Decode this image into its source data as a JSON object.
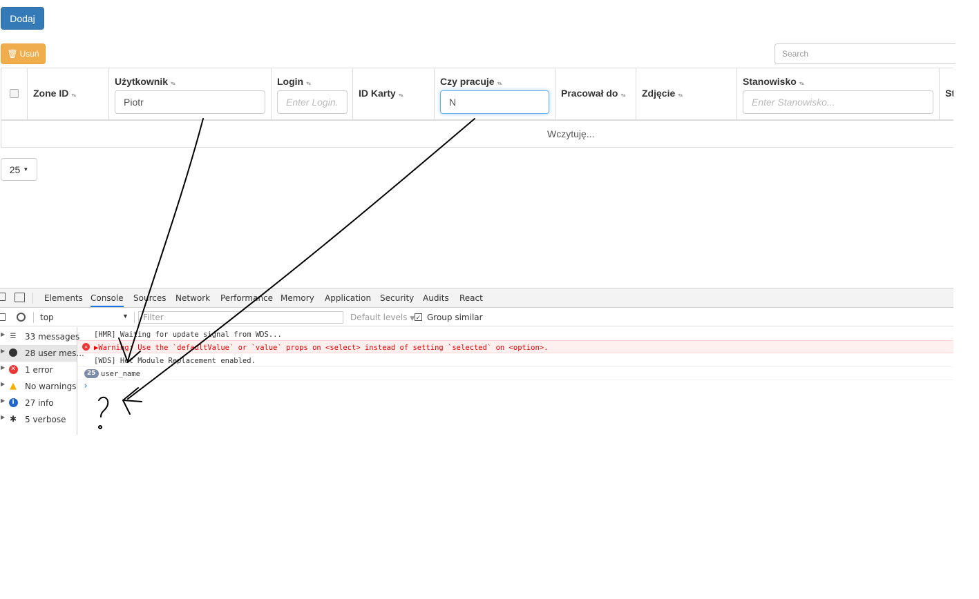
{
  "toolbar": {
    "add_label": "Dodaj",
    "delete_label": "Usuń",
    "search_placeholder": "Search"
  },
  "table": {
    "columns": [
      {
        "label": "Zone ID"
      },
      {
        "label": "Użytkownik",
        "filter_value": "Piotr"
      },
      {
        "label": "Login",
        "filter_placeholder": "Enter Login..."
      },
      {
        "label": "ID Karty"
      },
      {
        "label": "Czy pracuje",
        "filter_value": "N"
      },
      {
        "label": "Pracował do"
      },
      {
        "label": "Zdjęcie"
      },
      {
        "label": "Stanowisko",
        "filter_placeholder": "Enter Stanowisko..."
      },
      {
        "label": "St"
      }
    ],
    "loading_text": "Wczytuję...",
    "page_size": "25"
  },
  "devtools": {
    "tabs": [
      "Elements",
      "Console",
      "Sources",
      "Network",
      "Performance",
      "Memory",
      "Application",
      "Security",
      "Audits",
      "React"
    ],
    "active_tab": "Console",
    "context": "top",
    "filter_placeholder": "Filter",
    "levels": "Default levels",
    "group_similar": "Group similar",
    "sidebar": [
      {
        "label": "33 messages",
        "icon": "list-icon"
      },
      {
        "label": "28 user mes...",
        "icon": "user-icon"
      },
      {
        "label": "1 error",
        "icon": "error-icon"
      },
      {
        "label": "No warnings",
        "icon": "warning-icon"
      },
      {
        "label": "27 info",
        "icon": "info-icon"
      },
      {
        "label": "5 verbose",
        "icon": "bug-icon"
      }
    ],
    "logs": [
      {
        "text": "[HMR] Waiting for update signal from WDS..."
      },
      {
        "text": "▶Warning: Use the `defaultValue` or `value` props on <select> instead of setting `selected` on <option>."
      },
      {
        "text": "[WDS] Hot Module Replacement enabled."
      },
      {
        "text": "user_name",
        "count": "25"
      }
    ],
    "prompt": "›"
  },
  "annotation": {
    "text": "?"
  },
  "colors": {
    "primary": "#337ab7",
    "warning": "#f0ad4e",
    "error": "#e00000",
    "focus": "#66afe9"
  }
}
